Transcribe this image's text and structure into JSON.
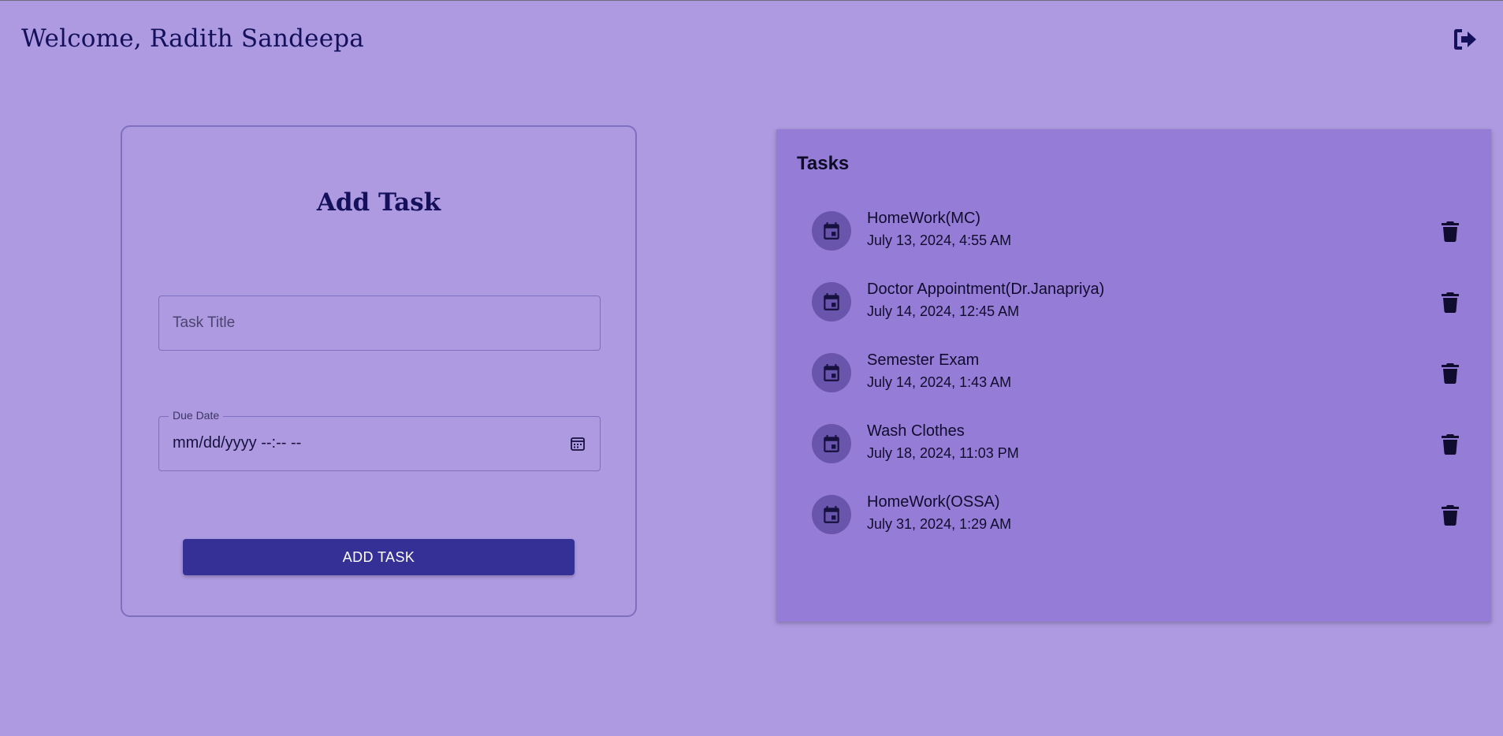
{
  "header": {
    "title": "Welcome, Radith Sandeepa",
    "logout_icon": "logout-icon"
  },
  "add_task": {
    "title": "Add Task",
    "task_title_placeholder": "Task Title",
    "task_title_value": "",
    "due_date_label": "Due Date",
    "due_date_value": "mm/dd/yyyy --:-- --",
    "submit_label": "ADD TASK"
  },
  "tasks": {
    "title": "Tasks",
    "items": [
      {
        "name": "HomeWork(MC)",
        "due": "July 13, 2024, 4:55 AM"
      },
      {
        "name": "Doctor Appointment(Dr.Janapriya)",
        "due": "July 14, 2024, 12:45 AM"
      },
      {
        "name": "Semester Exam",
        "due": "July 14, 2024, 1:43 AM"
      },
      {
        "name": "Wash Clothes",
        "due": "July 18, 2024, 11:03 PM"
      },
      {
        "name": "HomeWork(OSSA)",
        "due": "July 31, 2024, 1:29 AM"
      }
    ]
  },
  "colors": {
    "background": "#ad9ae0",
    "panel": "#957cd6",
    "primary_button": "#353096",
    "heading_text": "#14105c",
    "avatar": "#6a55ad"
  }
}
